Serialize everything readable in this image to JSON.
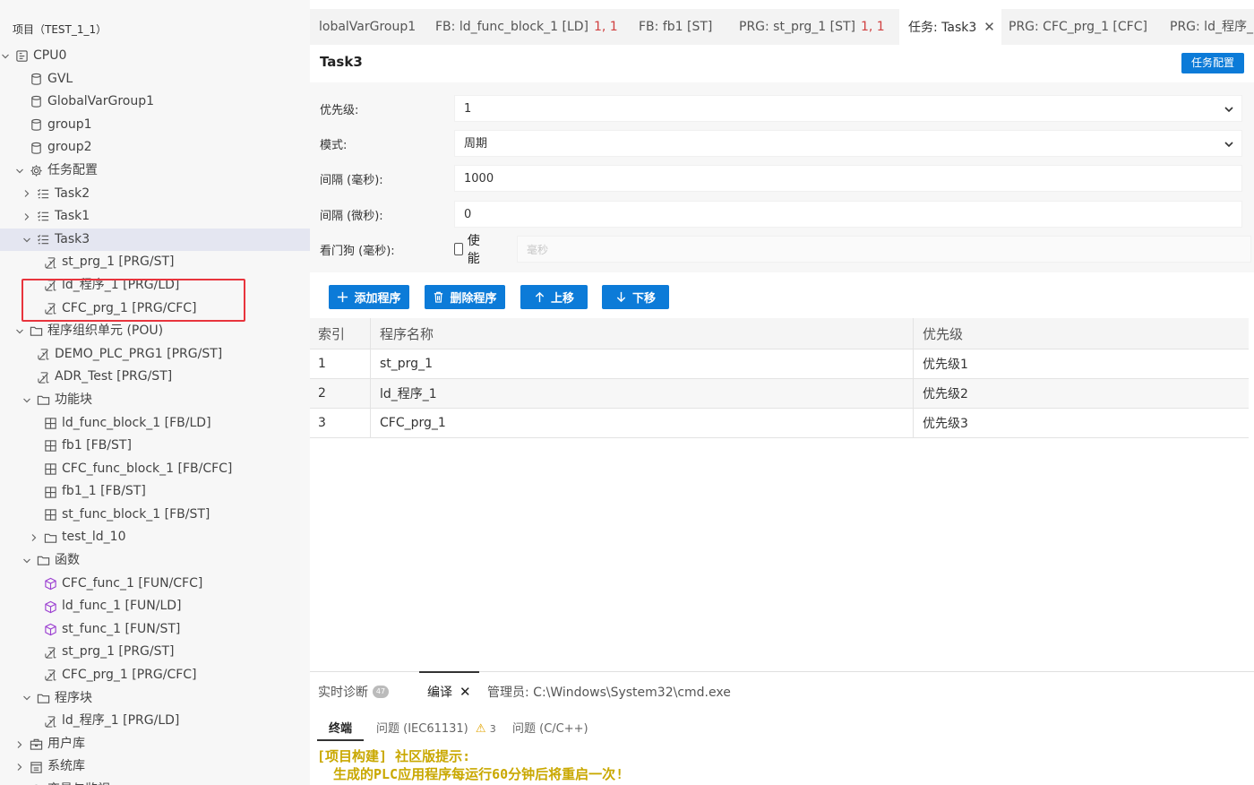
{
  "sidebar": {
    "header": "项目（TEST_1_1）",
    "tree": [
      {
        "label": "CPU0",
        "icon": "cpu-icon",
        "chevron": "down",
        "indent": 0
      },
      {
        "label": "GVL",
        "icon": "database-icon",
        "chevron": "",
        "indent": 1
      },
      {
        "label": "GlobalVarGroup1",
        "icon": "database-icon",
        "chevron": "",
        "indent": 1
      },
      {
        "label": "group1",
        "icon": "database-icon",
        "chevron": "",
        "indent": 1
      },
      {
        "label": "group2",
        "icon": "database-icon",
        "chevron": "",
        "indent": 1
      },
      {
        "label": "任务配置",
        "icon": "gear-icon",
        "chevron": "down",
        "indent": 1
      },
      {
        "label": "Task2",
        "icon": "task-list-icon",
        "chevron": "right",
        "indent": 2
      },
      {
        "label": "Task1",
        "icon": "task-list-icon",
        "chevron": "right",
        "indent": 2
      },
      {
        "label": "Task3",
        "icon": "task-list-icon",
        "chevron": "down",
        "indent": 2,
        "selected": true
      },
      {
        "label": "st_prg_1 [PRG/ST]",
        "icon": "program-icon",
        "chevron": "",
        "indent": 3
      },
      {
        "label": "ld_程序_1 [PRG/LD]",
        "icon": "program-icon",
        "chevron": "",
        "indent": 3
      },
      {
        "label": "CFC_prg_1 [PRG/CFC]",
        "icon": "program-icon",
        "chevron": "",
        "indent": 3
      },
      {
        "label": "程序组织单元 (POU)",
        "icon": "folder-icon",
        "chevron": "down",
        "indent": 1
      },
      {
        "label": "DEMO_PLC_PRG1 [PRG/ST]",
        "icon": "program-icon",
        "chevron": "",
        "indent": 2
      },
      {
        "label": "ADR_Test [PRG/ST]",
        "icon": "program-icon",
        "chevron": "",
        "indent": 2
      },
      {
        "label": "功能块",
        "icon": "folder-icon",
        "chevron": "down",
        "indent": 2
      },
      {
        "label": "ld_func_block_1 [FB/LD]",
        "icon": "function-block-icon",
        "chevron": "",
        "indent": 3
      },
      {
        "label": "fb1 [FB/ST]",
        "icon": "function-block-icon",
        "chevron": "",
        "indent": 3
      },
      {
        "label": "CFC_func_block_1 [FB/CFC]",
        "icon": "function-block-icon",
        "chevron": "",
        "indent": 3
      },
      {
        "label": "fb1_1 [FB/ST]",
        "icon": "function-block-icon",
        "chevron": "",
        "indent": 3
      },
      {
        "label": "st_func_block_1 [FB/ST]",
        "icon": "function-block-icon",
        "chevron": "",
        "indent": 3
      },
      {
        "label": "test_ld_10",
        "icon": "folder-icon",
        "chevron": "right",
        "indent": 3
      },
      {
        "label": "函数",
        "icon": "folder-icon",
        "chevron": "down",
        "indent": 2
      },
      {
        "label": "CFC_func_1 [FUN/CFC]",
        "icon": "function-icon",
        "chevron": "",
        "indent": 3
      },
      {
        "label": "ld_func_1 [FUN/LD]",
        "icon": "function-icon",
        "chevron": "",
        "indent": 3
      },
      {
        "label": "st_func_1 [FUN/ST]",
        "icon": "function-icon",
        "chevron": "",
        "indent": 3
      },
      {
        "label": "st_prg_1 [PRG/ST]",
        "icon": "program-icon",
        "chevron": "",
        "indent": 3
      },
      {
        "label": "CFC_prg_1 [PRG/CFC]",
        "icon": "program-icon",
        "chevron": "",
        "indent": 3
      },
      {
        "label": "程序块",
        "icon": "folder-icon",
        "chevron": "down",
        "indent": 2
      },
      {
        "label": "ld_程序_1 [PRG/LD]",
        "icon": "program-icon",
        "chevron": "",
        "indent": 3
      },
      {
        "label": "用户库",
        "icon": "library-icon",
        "chevron": "right",
        "indent": 1
      },
      {
        "label": "系统库",
        "icon": "system-library-icon",
        "chevron": "right",
        "indent": 1
      },
      {
        "label": "变量与监视",
        "icon": "watch-icon",
        "chevron": "right",
        "indent": 1
      }
    ]
  },
  "tabs": [
    {
      "label": "lobalVarGroup1",
      "dirty": "",
      "active": false,
      "closable": false
    },
    {
      "label": "FB: ld_func_block_1 [LD]",
      "dirty": "1, 1",
      "active": false,
      "closable": false
    },
    {
      "label": "FB: fb1 [ST]",
      "dirty": "",
      "active": false,
      "closable": false
    },
    {
      "label": "PRG: st_prg_1 [ST]",
      "dirty": "1, 1",
      "active": false,
      "closable": false
    },
    {
      "label": "任务: Task3",
      "dirty": "",
      "active": true,
      "closable": true
    },
    {
      "label": "PRG: CFC_prg_1 [CFC]",
      "dirty": "",
      "active": false,
      "closable": false
    },
    {
      "label": "PRG: ld_程序_",
      "dirty": "",
      "active": false,
      "closable": false
    }
  ],
  "content": {
    "title": "Task3",
    "config_button": "任务配置",
    "form": {
      "priority_label": "优先级:",
      "priority_value": "1",
      "mode_label": "模式:",
      "mode_value": "周期",
      "interval_ms_label": "间隔 (毫秒):",
      "interval_ms_value": "1000",
      "interval_us_label": "间隔 (微秒):",
      "interval_us_value": "0",
      "watchdog_label": "看门狗 (毫秒):",
      "watchdog_enable": "使能",
      "watchdog_placeholder": "毫秒"
    },
    "buttons": {
      "add": "添加程序",
      "delete": "删除程序",
      "up": "上移",
      "down": "下移"
    },
    "table": {
      "headers": [
        "索引",
        "程序名称",
        "优先级"
      ],
      "rows": [
        [
          "1",
          "st_prg_1",
          "优先级1"
        ],
        [
          "2",
          "ld_程序_1",
          "优先级2"
        ],
        [
          "3",
          "CFC_prg_1",
          "优先级3"
        ]
      ]
    }
  },
  "panel": {
    "tabs": {
      "diagnostics": "实时诊断",
      "diagnostics_count": "47",
      "compile": "编译",
      "terminal_title": "管理员: C:\\Windows\\System32\\cmd.exe"
    },
    "subtabs": {
      "terminal": "终端",
      "iec_problems": "问题 (IEC61131)",
      "iec_count": "3",
      "cpp_problems": "问题 (C/C++)"
    },
    "terminal_lines": [
      "[项目构建] 社区版提示:",
      "生成的PLC应用程序每运行60分钟后将重启一次!"
    ]
  },
  "colors": {
    "accent": "#0c7bd8",
    "highlight": "#e8343d",
    "dirty": "#d04040",
    "terminal_text": "#c9a800"
  }
}
